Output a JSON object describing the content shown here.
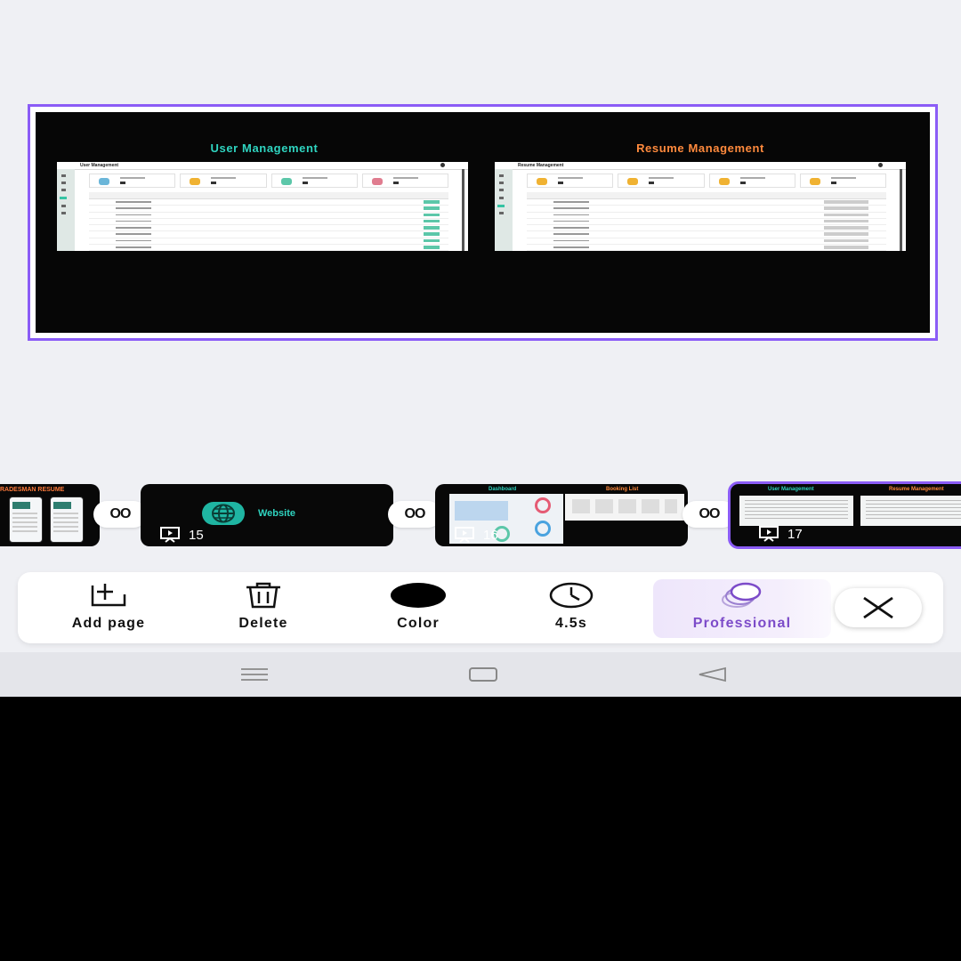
{
  "canvas": {
    "left_title": "User Management",
    "right_title": "Resume Management",
    "left_app_header": "User Management",
    "right_app_header": "Resume Management",
    "accent_border": "#8b5cf6"
  },
  "thumbnails": [
    {
      "label": "RADESMAN RESUME",
      "selected": false
    },
    {
      "label": "Website",
      "number": "15",
      "selected": false
    },
    {
      "label_left": "Dashboard",
      "label_right": "Booking List",
      "number": "16",
      "selected": false
    },
    {
      "label_left": "User Management",
      "label_right": "Resume Management",
      "number": "17",
      "selected": true
    }
  ],
  "connectors": [
    "OO",
    "OO",
    "OO"
  ],
  "toolbar": {
    "add_page": "Add page",
    "delete": "Delete",
    "color": "Color",
    "duration": "4.5s",
    "style": "Professional",
    "color_swatch": "#000000",
    "style_accent": "#7c4bc9"
  }
}
